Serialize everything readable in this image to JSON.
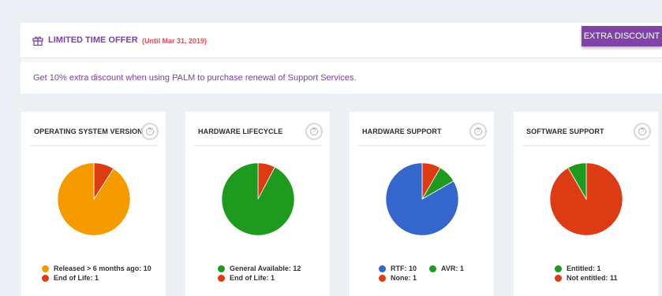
{
  "offer": {
    "title": "LIMITED TIME OFFER",
    "until": "(Until Mar 31, 2019)",
    "message": "Get 10% extra discount when using PALM to purchase renewal of Support Services.",
    "button_label": "EXTRA DISCOUNT"
  },
  "cards": [
    {
      "title": "OPERATING SYSTEM VERSION",
      "help_label": "?",
      "segments": [
        {
          "label": "Released > 6 months ago",
          "value": 10,
          "color": "#f59b00"
        },
        {
          "label": "End of Life",
          "value": 1,
          "color": "#dd3b14"
        }
      ],
      "legend": [
        "Released > 6 months ago: 10",
        "End of Life: 1"
      ]
    },
    {
      "title": "HARDWARE LIFECYCLE",
      "help_label": "?",
      "segments": [
        {
          "label": "General Available",
          "value": 12,
          "color": "#1e9a1e"
        },
        {
          "label": "End of Life",
          "value": 1,
          "color": "#dd3b14"
        }
      ],
      "legend": [
        "General Available: 12",
        "End of Life: 1"
      ]
    },
    {
      "title": "HARDWARE SUPPORT",
      "help_label": "?",
      "segments": [
        {
          "label": "RTF",
          "value": 10,
          "color": "#3466cc"
        },
        {
          "label": "AVR",
          "value": 1,
          "color": "#1e9a1e"
        },
        {
          "label": "None",
          "value": 1,
          "color": "#dd3b14"
        }
      ],
      "legend": [
        "RTF: 10",
        "AVR: 1",
        "None: 1"
      ]
    },
    {
      "title": "SOFTWARE SUPPORT",
      "help_label": "?",
      "segments": [
        {
          "label": "Entitled",
          "value": 1,
          "color": "#1e9a1e"
        },
        {
          "label": "Not entitled",
          "value": 11,
          "color": "#dd3b14"
        }
      ],
      "legend": [
        "Entitled: 1",
        "Not entitled: 11"
      ]
    }
  ]
}
